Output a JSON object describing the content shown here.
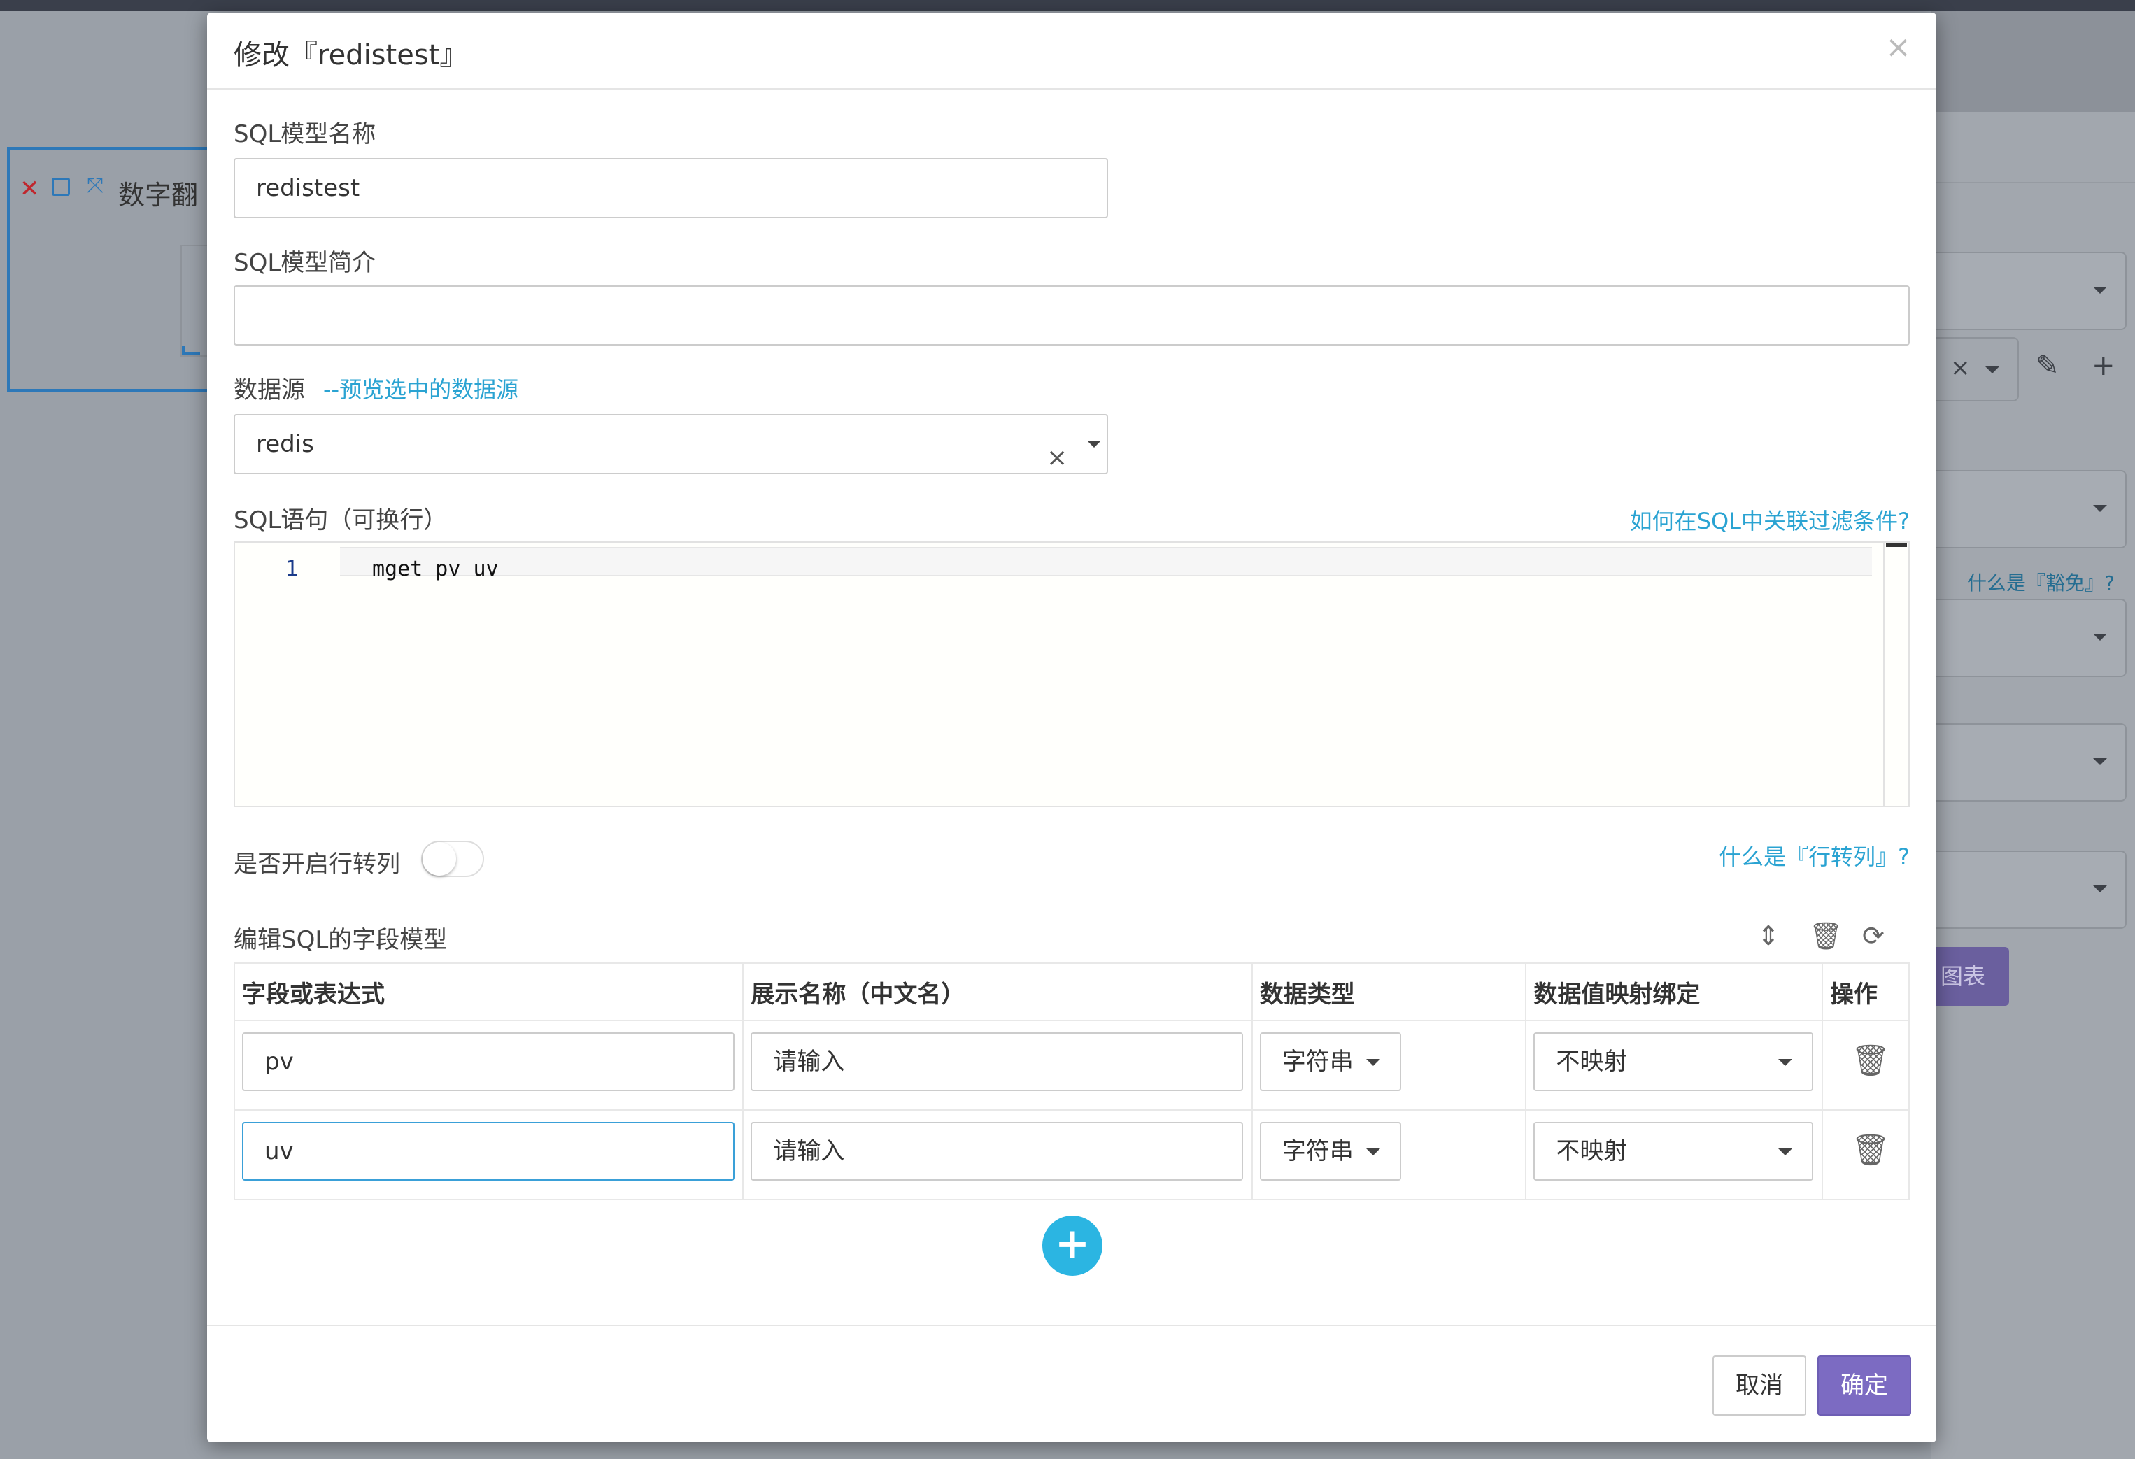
{
  "background": {
    "widget_title": "数字翻",
    "right_hint": "什么是『豁免』?",
    "right_button": "图表"
  },
  "modal": {
    "title": "修改『redistest』",
    "close_icon": "×"
  },
  "form": {
    "name_label": "SQL模型名称",
    "name_value": "redistest",
    "desc_label": "SQL模型简介",
    "desc_value": "",
    "datasource_label": "数据源",
    "datasource_preview_link": "--预览选中的数据源",
    "datasource_value": "redis",
    "sql_label": "SQL语句（可换行）",
    "sql_help_link": "如何在SQL中关联过滤条件?",
    "sql_line_number": "1",
    "sql_code": "mget pv uv",
    "row_to_col_label": "是否开启行转列",
    "row_to_col_enabled": false,
    "row_to_col_help_link": "什么是『行转列』?",
    "fields_label": "编辑SQL的字段模型"
  },
  "table": {
    "headers": [
      "字段或表达式",
      "展示名称（中文名）",
      "数据类型",
      "数据值映射绑定",
      "操作"
    ],
    "rows": [
      {
        "field": "pv",
        "display_placeholder": "请输入",
        "type": "字符串",
        "mapping": "不映射"
      },
      {
        "field": "uv",
        "display_placeholder": "请输入",
        "type": "字符串",
        "mapping": "不映射"
      }
    ]
  },
  "footer": {
    "cancel_label": "取消",
    "confirm_label": "确定"
  },
  "icons": {
    "sort": "sort-icon",
    "trash": "trash-icon",
    "refresh": "refresh-icon",
    "add": "plus-icon"
  },
  "colors": {
    "link": "#2aa3d2",
    "primary": "#7c6bc2",
    "add_button": "#2bb5e2",
    "focus_border": "#3aa0d8"
  }
}
